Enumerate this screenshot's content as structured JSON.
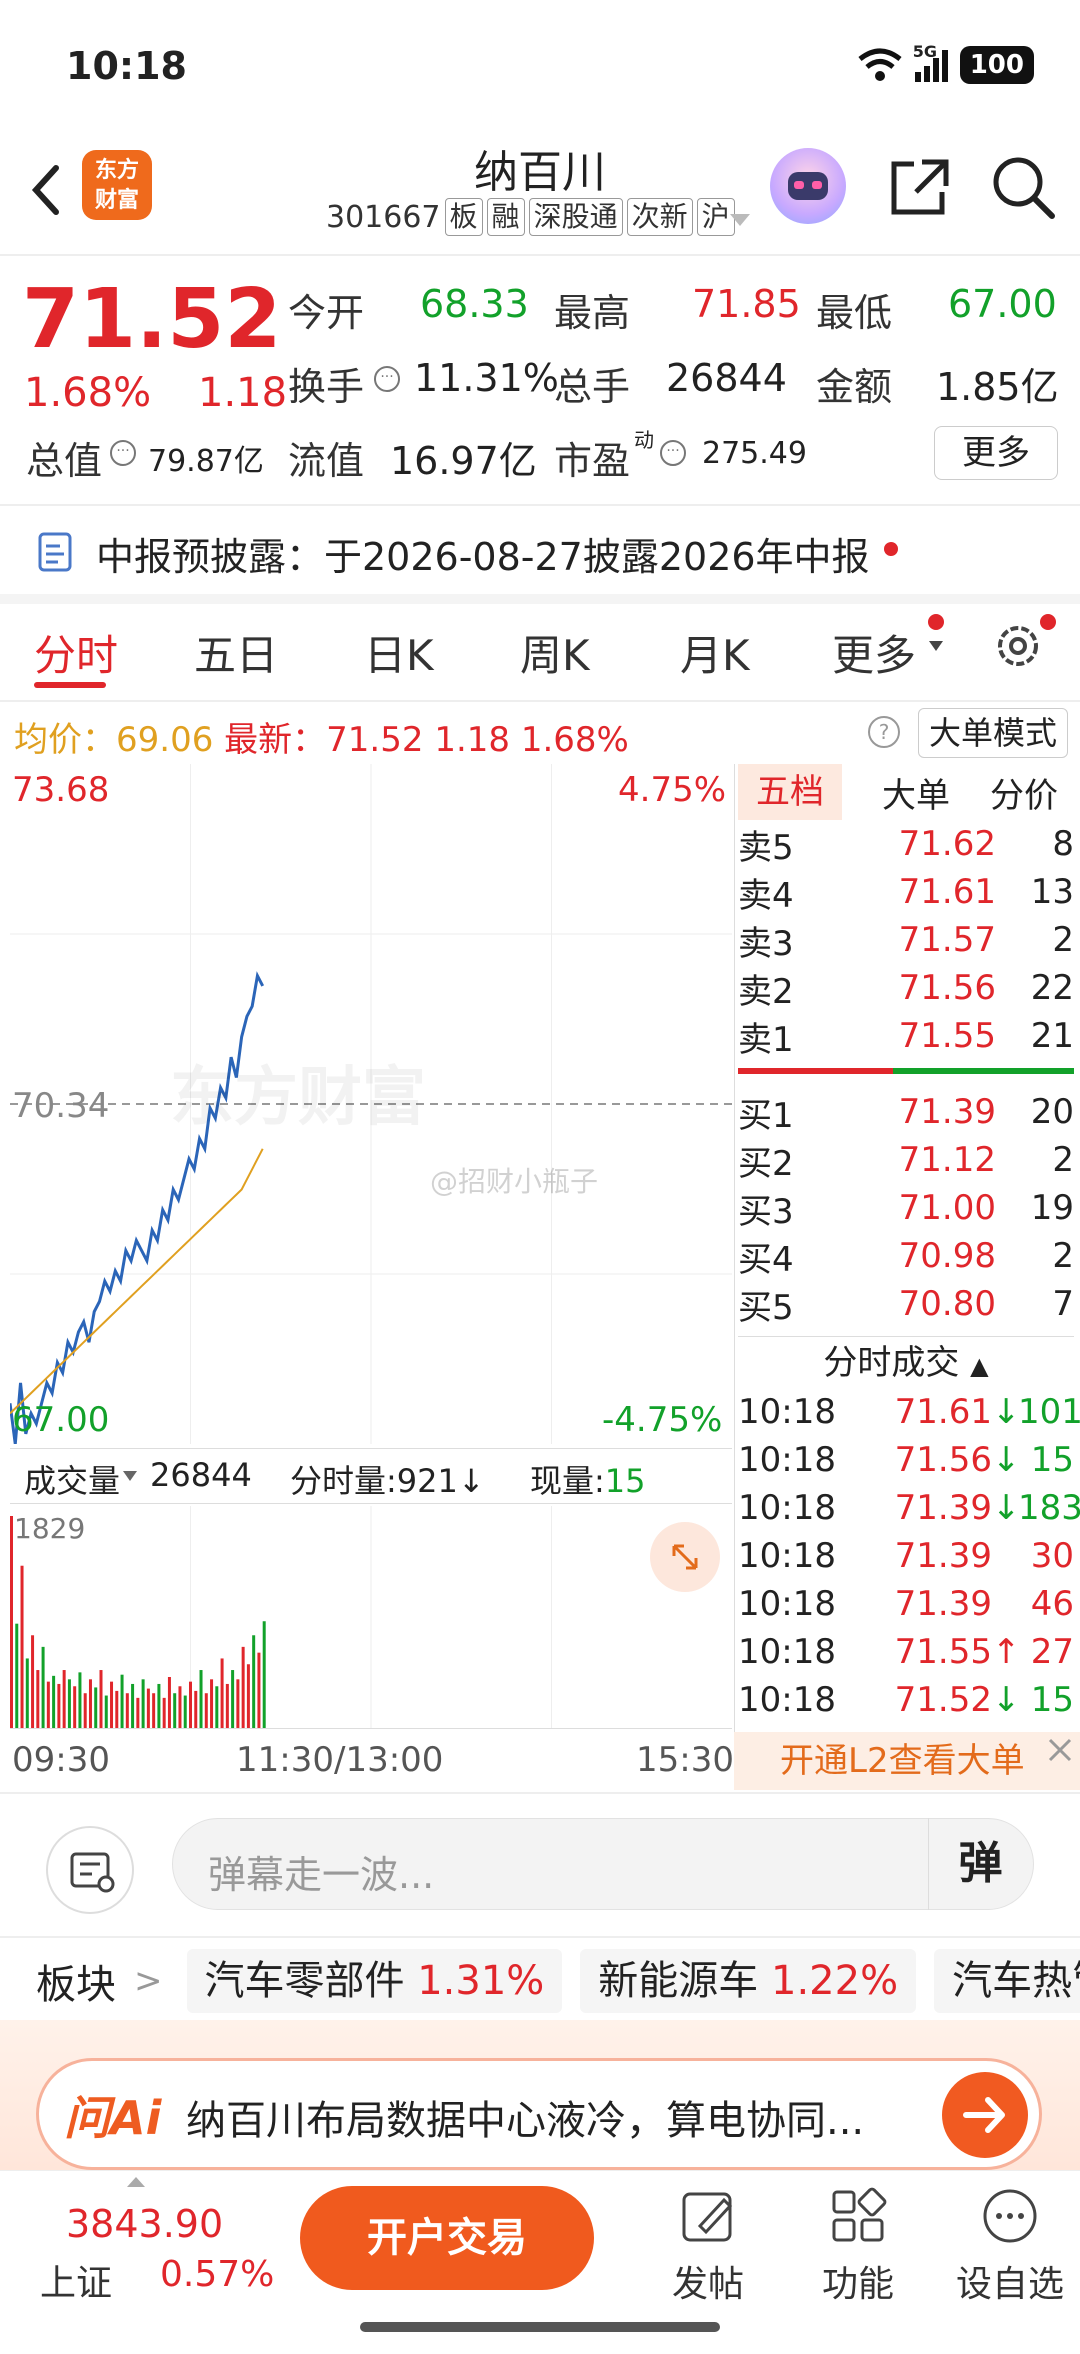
{
  "status_bar": {
    "time": "10:18",
    "network": "5G",
    "battery": "100"
  },
  "header": {
    "logo_text": "东方\n财富",
    "name": "纳百川",
    "code": "301667",
    "tags": [
      "板",
      "融",
      "深股通",
      "次新",
      "沪"
    ]
  },
  "quote": {
    "price": "71.52",
    "change_pct": "1.68%",
    "change": "1.18",
    "open_label": "今开",
    "open": "68.33",
    "high_label": "最高",
    "high": "71.85",
    "low_label": "最低",
    "low": "67.00",
    "turnover_label": "换手",
    "turnover": "11.31%",
    "volume_label": "总手",
    "volume": "26844",
    "amount_label": "金额",
    "amount": "1.85亿",
    "mktcap_label": "总值",
    "mktcap": "79.87亿",
    "float_label": "流值",
    "float_cap": "16.97亿",
    "pe_label": "市盈",
    "pe_sup": "动",
    "pe": "275.49",
    "more_label": "更多"
  },
  "notice": {
    "text": "中报预披露：于2026-08-27披露2026年中报"
  },
  "tabs": [
    "分时",
    "五日",
    "日K",
    "周K",
    "月K",
    "更多"
  ],
  "info_line": {
    "avg_label": "均价：",
    "avg": "69.06",
    "last_label": "最新：",
    "last": "71.52",
    "chg": "1.18",
    "pct": "1.68%",
    "mode_label": "大单模式"
  },
  "chart": {
    "y_top": "73.68",
    "y_mid": "70.34",
    "y_bottom": "67.00",
    "pct_top": "4.75%",
    "pct_bottom": "-4.75%",
    "x_labels": [
      "09:30",
      "11:30/13:00",
      "15:30"
    ],
    "watermark": "东方财富",
    "watermark2": "@招财小瓶子",
    "colors": {
      "price_line": "#2b65b8",
      "avg_line": "#e0a020",
      "up": "#e0262b",
      "down": "#12a12a"
    }
  },
  "chart_data": {
    "type": "line",
    "x": [
      "09:30",
      "09:31",
      "09:32",
      "09:33",
      "09:34",
      "09:35",
      "09:36",
      "09:37",
      "09:38",
      "09:39",
      "09:40",
      "09:41",
      "09:42",
      "09:43",
      "09:44",
      "09:45",
      "09:46",
      "09:47",
      "09:48",
      "09:49",
      "09:50",
      "09:51",
      "09:52",
      "09:53",
      "09:54",
      "09:55",
      "09:56",
      "09:57",
      "09:58",
      "09:59",
      "10:00",
      "10:01",
      "10:02",
      "10:03",
      "10:04",
      "10:05",
      "10:06",
      "10:07",
      "10:08",
      "10:09",
      "10:10",
      "10:11",
      "10:12",
      "10:13",
      "10:14",
      "10:15",
      "10:16",
      "10:17",
      "10:18"
    ],
    "series": [
      {
        "values": [
          67.4,
          67.0,
          67.6,
          67.1,
          67.3,
          67.2,
          67.4,
          67.6,
          67.5,
          67.8,
          67.7,
          68.0,
          67.9,
          68.1,
          68.2,
          68.0,
          68.3,
          68.4,
          68.6,
          68.5,
          68.7,
          68.6,
          68.9,
          68.8,
          69.0,
          68.9,
          68.8,
          69.1,
          69.0,
          69.3,
          69.2,
          69.5,
          69.4,
          69.6,
          69.8,
          69.7,
          70.0,
          69.9,
          70.3,
          70.2,
          70.5,
          70.4,
          70.8,
          70.6,
          71.0,
          71.2,
          71.3,
          71.6,
          71.5
        ]
      },
      {
        "values": [
          67.3,
          67.35,
          67.4,
          67.45,
          67.5,
          67.55,
          67.6,
          67.65,
          67.7,
          67.75,
          67.8,
          67.85,
          67.9,
          67.95,
          68.0,
          68.05,
          68.1,
          68.15,
          68.2,
          68.25,
          68.3,
          68.35,
          68.4,
          68.45,
          68.5,
          68.55,
          68.6,
          68.65,
          68.7,
          68.75,
          68.8,
          68.85,
          68.9,
          68.95,
          69.0,
          69.05,
          69.1,
          69.15,
          69.2,
          69.25,
          69.3,
          69.35,
          69.4,
          69.45,
          69.5,
          69.6,
          69.7,
          69.8,
          69.9
        ]
      }
    ],
    "ylim": [
      67.0,
      73.68
    ],
    "xlim": [
      "09:30",
      "15:30"
    ]
  },
  "volume": {
    "label": "成交量",
    "total": "26844",
    "min_label": "分时量:",
    "min_vol": "921↓",
    "cur_label": "现量:",
    "cur": "15",
    "ymax": "1829",
    "bars": [
      1829,
      900,
      1400,
      600,
      800,
      500,
      700,
      400,
      450,
      380,
      500,
      420,
      360,
      480,
      300,
      420,
      350,
      500,
      280,
      400,
      320,
      460,
      300,
      380,
      260,
      420,
      340,
      300,
      380,
      260,
      440,
      300,
      360,
      280,
      400,
      320,
      500,
      300,
      420,
      360,
      600,
      380,
      500,
      420,
      700,
      550,
      800,
      650,
      921
    ],
    "dirs": [
      "u",
      "d",
      "u",
      "d",
      "u",
      "u",
      "d",
      "u",
      "d",
      "u",
      "u",
      "d",
      "u",
      "d",
      "u",
      "u",
      "d",
      "u",
      "d",
      "u",
      "u",
      "d",
      "u",
      "d",
      "u",
      "d",
      "u",
      "u",
      "d",
      "u",
      "u",
      "d",
      "u",
      "d",
      "u",
      "u",
      "d",
      "u",
      "u",
      "d",
      "u",
      "u",
      "d",
      "u",
      "u",
      "u",
      "d",
      "u",
      "d"
    ]
  },
  "orderbook": {
    "tabs": [
      "五档",
      "大单",
      "分价"
    ],
    "asks": [
      {
        "label": "卖5",
        "price": "71.62",
        "qty": "8"
      },
      {
        "label": "卖4",
        "price": "71.61",
        "qty": "13"
      },
      {
        "label": "卖3",
        "price": "71.57",
        "qty": "2"
      },
      {
        "label": "卖2",
        "price": "71.56",
        "qty": "22"
      },
      {
        "label": "卖1",
        "price": "71.55",
        "qty": "21"
      }
    ],
    "bids": [
      {
        "label": "买1",
        "price": "71.39",
        "qty": "20"
      },
      {
        "label": "买2",
        "price": "71.12",
        "qty": "2"
      },
      {
        "label": "买3",
        "price": "71.00",
        "qty": "19"
      },
      {
        "label": "买4",
        "price": "70.98",
        "qty": "2"
      },
      {
        "label": "买5",
        "price": "70.80",
        "qty": "7"
      }
    ],
    "ticks_title": "分时成交",
    "ticks": [
      {
        "time": "10:18",
        "price": "71.61",
        "arrow": "↓",
        "qty": "101",
        "dir": "d"
      },
      {
        "time": "10:18",
        "price": "71.56",
        "arrow": "↓",
        "qty": "15",
        "dir": "d"
      },
      {
        "time": "10:18",
        "price": "71.39",
        "arrow": "↓",
        "qty": "183",
        "dir": "d"
      },
      {
        "time": "10:18",
        "price": "71.39",
        "arrow": "",
        "qty": "30",
        "dir": "u"
      },
      {
        "time": "10:18",
        "price": "71.39",
        "arrow": "",
        "qty": "46",
        "dir": "u"
      },
      {
        "time": "10:18",
        "price": "71.55",
        "arrow": "↑",
        "qty": "27",
        "dir": "u"
      },
      {
        "time": "10:18",
        "price": "71.52",
        "arrow": "↓",
        "qty": "15",
        "dir": "d"
      }
    ],
    "l2_label": "开通L2查看大单"
  },
  "danmu": {
    "placeholder": "弹幕走一波...",
    "button": "弹"
  },
  "sectors": {
    "label": "板块",
    "items": [
      {
        "name": "汽车零部件",
        "pct": "1.31%"
      },
      {
        "name": "新能源车",
        "pct": "1.22%"
      },
      {
        "name": "汽车热管",
        "pct": ""
      }
    ]
  },
  "ai": {
    "logo": "问Ai",
    "text": "纳百川布局数据中心液冷，算电协同..."
  },
  "bottom_nav": {
    "index_value": "3843.90",
    "index_name": "上证",
    "index_pct": "0.57%",
    "open_button": "开户交易",
    "items": [
      "发帖",
      "功能",
      "设自选"
    ]
  }
}
